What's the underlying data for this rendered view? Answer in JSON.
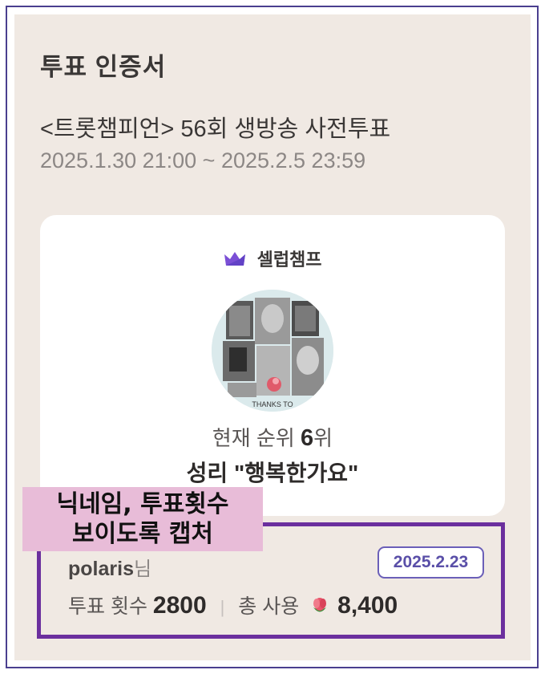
{
  "certificate": {
    "title": "투표 인증서",
    "event_name": "<트롯챔피언> 56회 생방송 사전투표",
    "period": "2025.1.30 21:00 ~ 2025.2.5 23:59"
  },
  "card": {
    "brand": "셀럽챔프",
    "brand_icon": "crown-icon",
    "brand_color": "#7b4fd6",
    "avatar_caption": "THANKS TO",
    "rank_label": "현재 순위",
    "rank_value": "6",
    "rank_suffix": "위",
    "song": "성리 \"행복한가요\""
  },
  "vote": {
    "nickname": "polaris",
    "nickname_suffix": "님",
    "date": "2025.2.23",
    "count_label": "투표 횟수",
    "count_value": "2800",
    "total_label": "총 사용",
    "total_icon": "flower-icon",
    "total_value": "8,400",
    "highlight_color": "#6b2f9e"
  },
  "sticker": {
    "line1": "닉네임, 투표횟수",
    "line2": "보이도록 캡처",
    "color": "#e8bcd8"
  }
}
